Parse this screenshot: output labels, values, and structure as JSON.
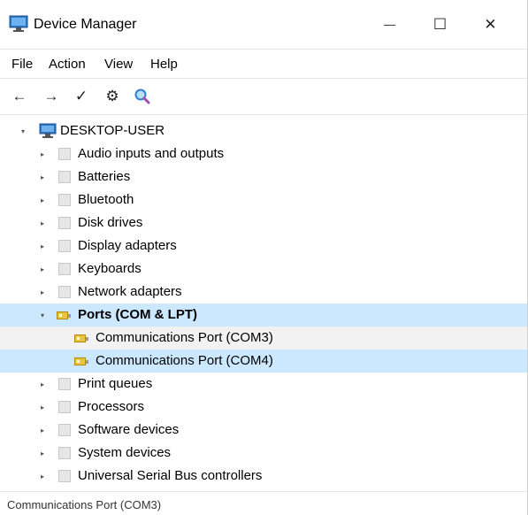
{
  "window": {
    "title": "Device Manager",
    "controls": {
      "minimize": "—",
      "maximize": "☐",
      "close": "✕"
    }
  },
  "menu": [
    "File",
    "Action",
    "View",
    "Help"
  ],
  "toolbar": {
    "back": "←",
    "forward": "→",
    "check": "✓",
    "properties": "⚙",
    "scan": "🔍"
  },
  "tree": {
    "root": "DESKTOP-USER",
    "categories": [
      "Audio inputs and outputs",
      "Batteries",
      "Bluetooth",
      "Disk drives",
      "Display adapters",
      "Keyboards",
      "Network adapters",
      "Ports (COM & LPT)",
      "Print queues",
      "Processors",
      "Software devices",
      "System devices",
      "Universal Serial Bus controllers"
    ],
    "ports_children": [
      "Communications Port (COM3)",
      "Communications Port (COM4)"
    ],
    "selected": "Communications Port (COM4)"
  },
  "status": {
    "text": "Communications Port (COM3)"
  },
  "colors": {
    "selection": "#cce8ff",
    "hover": "#f2f2f2",
    "port_icon": "#e8c53a"
  }
}
